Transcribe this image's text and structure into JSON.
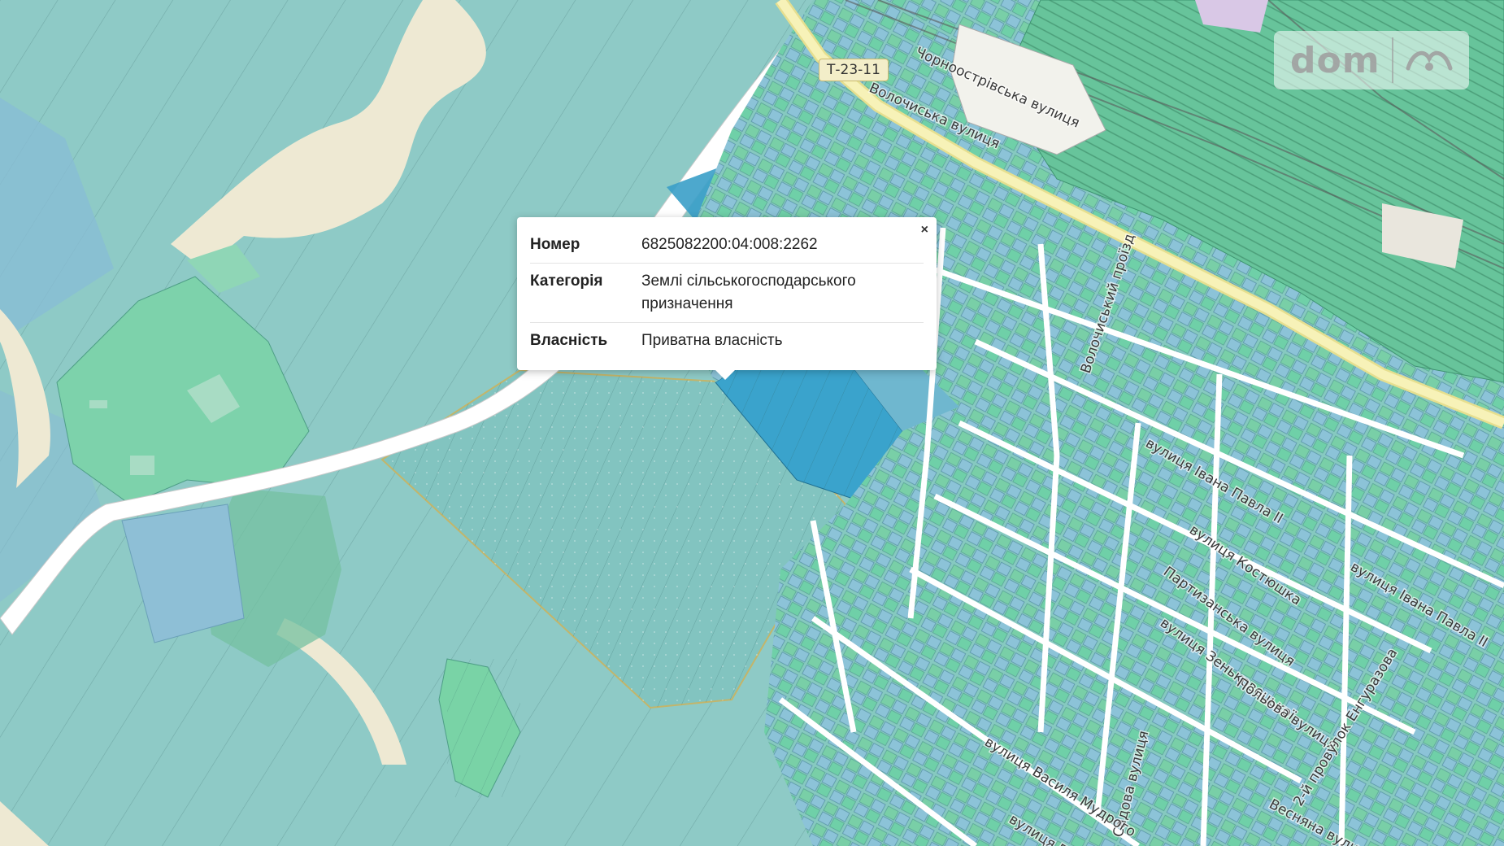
{
  "map": {
    "streets": [
      {
        "name": "Волочиська вулиця"
      },
      {
        "name": "Чорноострівська вулиця"
      },
      {
        "name": "Волочиський проїзд"
      },
      {
        "name": "вулиця Івана Павла ІІ"
      },
      {
        "name": "вулиця Костюшка"
      },
      {
        "name": "Партизанська вулиця"
      },
      {
        "name": "вулиця Зеньковецької"
      },
      {
        "name": "Польова вулиця"
      },
      {
        "name": "2-й провулок Енгуразова"
      },
      {
        "name": "вулиця Івана Павла ІІ"
      },
      {
        "name": "Садова вулиця"
      },
      {
        "name": "Весняна вулиця"
      },
      {
        "name": "вулиця Василя Мудрого"
      },
      {
        "name": "вулиця Гагаріна"
      }
    ],
    "road_ref": "Т-23-11",
    "watermark": {
      "text": "dom",
      "icon": "ria-logo-icon"
    },
    "colors": {
      "agri_parcel": "#8ecac6",
      "forest": "#76cfa9",
      "residential_parcel": "#79c9ab",
      "selected_parcel": "#3aa3cc",
      "private_parcel": "#85bcd6",
      "road": "#f6f2d6",
      "rail_zone": "#5fbd94"
    }
  },
  "popup": {
    "close_label": "×",
    "rows": [
      {
        "key": "Номер",
        "value": "6825082200:04:008:2262"
      },
      {
        "key": "Категорія",
        "value": "Землі сільськогосподарського призначення"
      },
      {
        "key": "Власність",
        "value": "Приватна власність"
      }
    ]
  }
}
